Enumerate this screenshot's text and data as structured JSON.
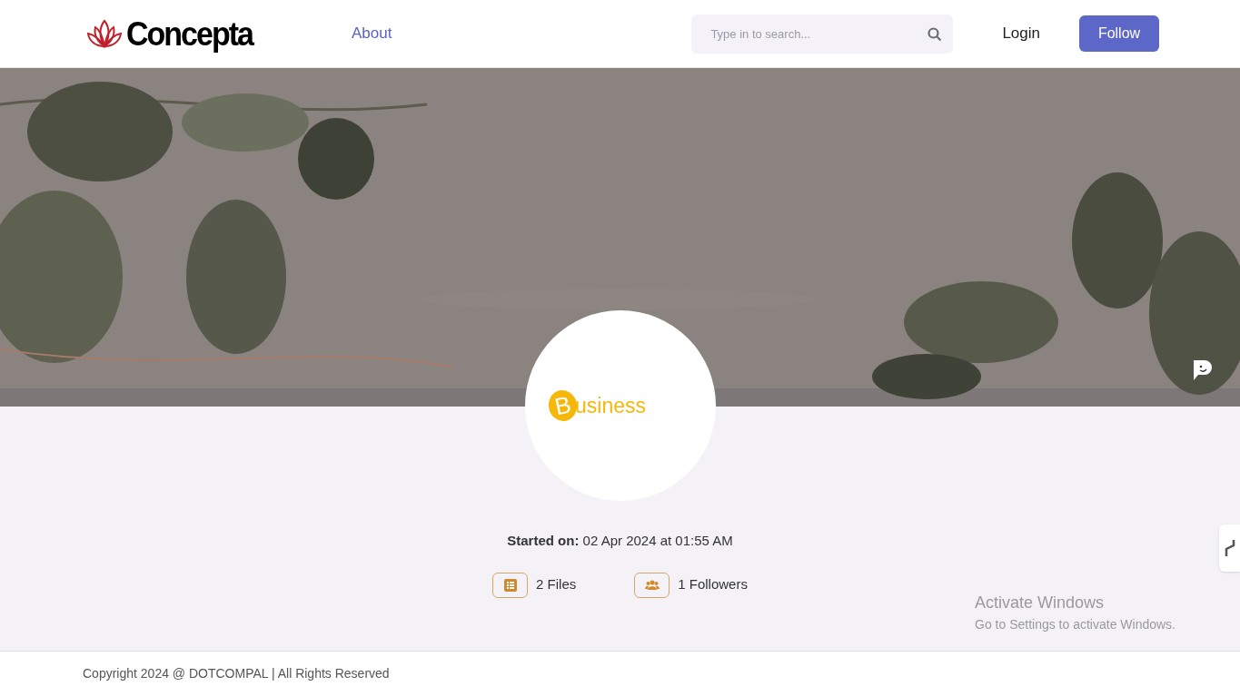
{
  "header": {
    "logo": "Concepta",
    "nav": [
      {
        "label": "About"
      }
    ],
    "search": {
      "placeholder": "Type in to search..."
    },
    "login": "Login",
    "follow": "Follow"
  },
  "profile": {
    "avatar": {
      "logo_initial": "B",
      "logo_rest": "usiness"
    },
    "started_label": "Started on:",
    "started_value": "02 Apr 2024 at 01:55 AM",
    "stats": [
      {
        "kind": "files",
        "text": "2 Files"
      },
      {
        "kind": "followers",
        "text": "1 Followers"
      }
    ]
  },
  "activation": {
    "title": "Activate Windows",
    "subtitle": "Go to Settings to activate Windows."
  },
  "footer": {
    "copyright": "Copyright 2024 @ DOTCOMPAL | All Rights Reserved"
  }
}
